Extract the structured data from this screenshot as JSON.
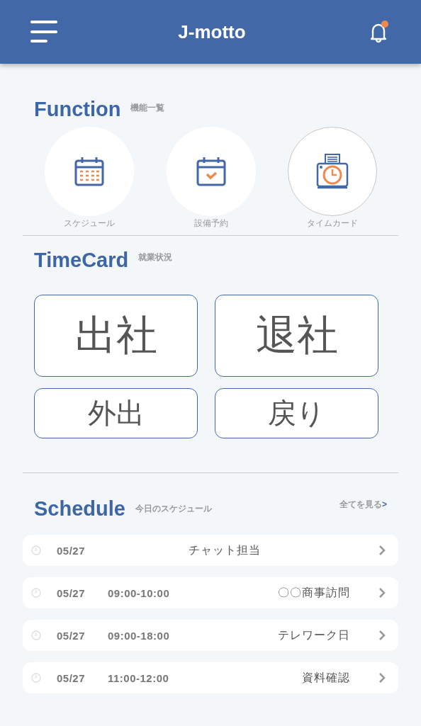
{
  "header": {
    "title": "J-motto",
    "notification": {
      "unread": true
    }
  },
  "function": {
    "title": "Function",
    "subtitle": "機能一覧",
    "items": [
      {
        "kind": "calendar",
        "label": "スケジュール",
        "selected": false
      },
      {
        "kind": "booking",
        "label": "設備予約",
        "selected": false
      },
      {
        "kind": "timeclock",
        "label": "タイムカード",
        "selected": true
      }
    ]
  },
  "timecard": {
    "title": "TimeCard",
    "subtitle": "就業状況",
    "buttons": [
      {
        "label": "出社",
        "kind": "main"
      },
      {
        "label": "退社",
        "kind": "main"
      },
      {
        "label": "外出",
        "kind": "sub"
      },
      {
        "label": "戻り",
        "kind": "sub"
      }
    ]
  },
  "schedule": {
    "title": "Schedule",
    "subtitle": "今日のスケジュール",
    "see_all": {
      "label": "全てを見る",
      "arrow": ">"
    },
    "rows": [
      {
        "date": "05/27",
        "title": "チャット担当"
      },
      {
        "date": "05/27",
        "time": "09:00-10:00",
        "title": "〇〇商事訪問"
      },
      {
        "date": "05/27",
        "time": "09:00-18:00",
        "title": "テレワーク日"
      },
      {
        "date": "05/27",
        "time": "11:00-12:00",
        "title": "資料確認"
      }
    ]
  }
}
